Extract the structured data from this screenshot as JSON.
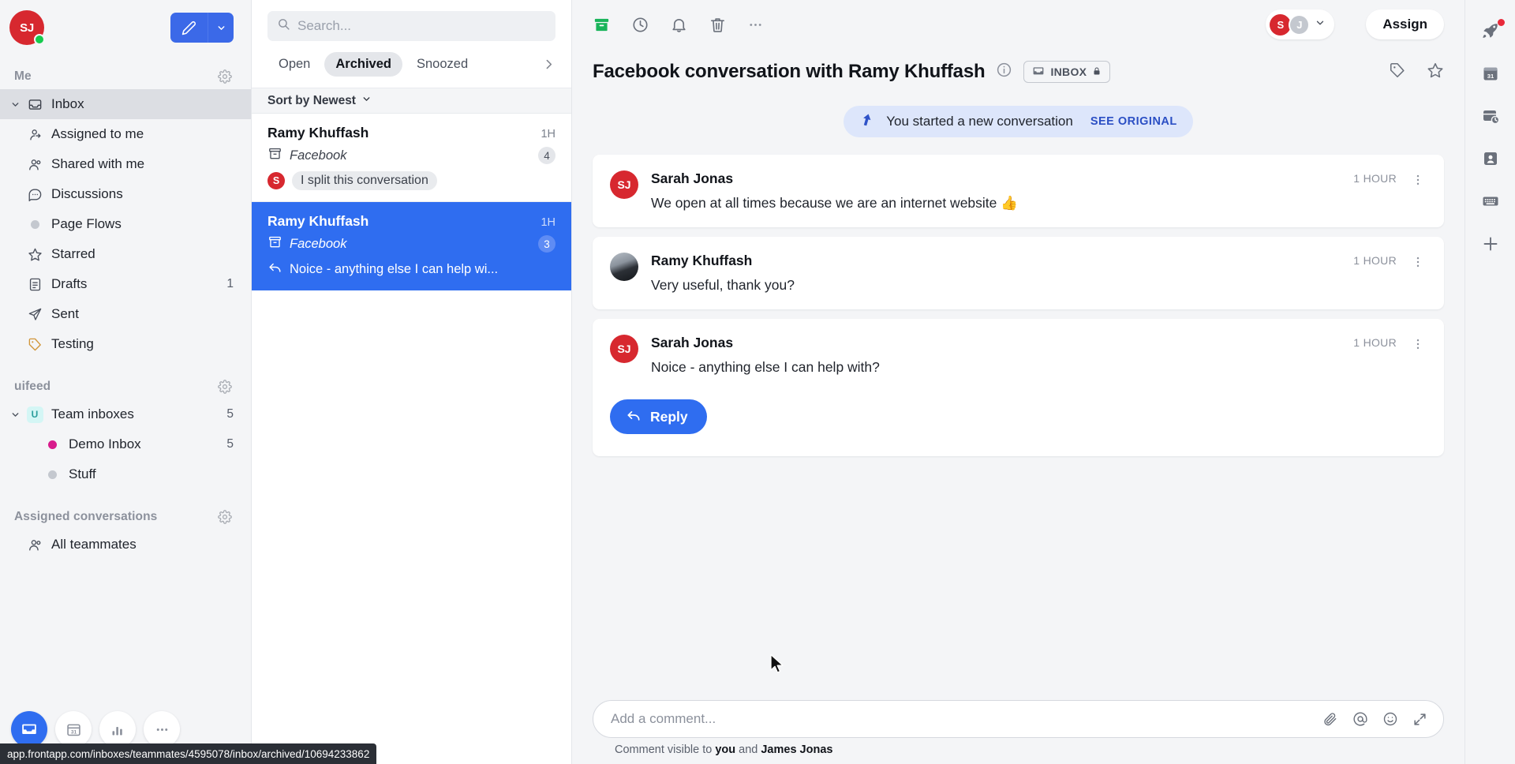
{
  "sidebar": {
    "user_avatar_initials": "SJ",
    "presence": "online",
    "compose_icon": "pencil-icon",
    "compose_caret_icon": "chevron-down-icon",
    "sections": [
      {
        "title": "Me",
        "has_gear": true,
        "items": [
          {
            "label": "Inbox",
            "icon": "inbox-icon",
            "level": 0,
            "selected": true,
            "expanded": true,
            "count": ""
          },
          {
            "label": "Assigned to me",
            "icon": "assigned-user-icon",
            "level": 1,
            "selected": false,
            "count": ""
          },
          {
            "label": "Shared with me",
            "icon": "shared-users-icon",
            "level": 1,
            "selected": false,
            "count": ""
          },
          {
            "label": "Discussions",
            "icon": "chat-bubble-icon",
            "level": 1,
            "selected": false,
            "count": ""
          },
          {
            "label": "Page Flows",
            "icon": "dot-icon",
            "level": 1,
            "selected": false,
            "count": ""
          },
          {
            "label": "Starred",
            "icon": "star-icon",
            "level": 0,
            "selected": false,
            "count": ""
          },
          {
            "label": "Drafts",
            "icon": "draft-document-icon",
            "level": 0,
            "selected": false,
            "count": "1"
          },
          {
            "label": "Sent",
            "icon": "send-paper-plane-icon",
            "level": 0,
            "selected": false,
            "count": ""
          },
          {
            "label": "Testing",
            "icon": "tag-icon",
            "level": 0,
            "selected": false,
            "count": ""
          }
        ]
      },
      {
        "title": "uifeed",
        "has_gear": true,
        "items": [
          {
            "label": "Team inboxes",
            "icon": "team-badge-icon",
            "badge_letter": "U",
            "level": 0,
            "selected": false,
            "expanded": true,
            "count": "5"
          },
          {
            "label": "Demo Inbox",
            "icon": "dot-magenta-icon",
            "level": 1,
            "selected": false,
            "count": "5"
          },
          {
            "label": "Stuff",
            "icon": "dot-icon",
            "level": 1,
            "selected": false,
            "count": ""
          }
        ]
      },
      {
        "title": "Assigned conversations",
        "has_gear": true,
        "items": [
          {
            "label": "All teammates",
            "icon": "shared-users-icon",
            "level": 1,
            "selected": false,
            "count": ""
          }
        ]
      }
    ],
    "dock": [
      {
        "name": "inbox-app-button",
        "icon": "inbox-icon",
        "active": true
      },
      {
        "name": "calendar-app-button",
        "icon": "calendar-31-icon",
        "active": false
      },
      {
        "name": "analytics-app-button",
        "icon": "bar-chart-icon",
        "active": false
      },
      {
        "name": "more-apps-button",
        "icon": "ellipsis-icon",
        "active": false
      }
    ],
    "status_url": "app.frontapp.com/inboxes/teammates/4595078/inbox/archived/10694233862"
  },
  "list": {
    "search": {
      "placeholder": "Search...",
      "value": "",
      "icon": "search-icon"
    },
    "tabs": [
      {
        "label": "Open",
        "active": false
      },
      {
        "label": "Archived",
        "active": true
      },
      {
        "label": "Snoozed",
        "active": false
      }
    ],
    "tabs_more_icon": "chevron-right-icon",
    "sort_label": "Sort by Newest",
    "sort_caret": "chevron-down-icon",
    "conversations": [
      {
        "name": "Ramy Khuffash",
        "time": "1H",
        "channel": "Facebook",
        "channel_icon": "archive-box-icon",
        "badge": "4",
        "preview": "I split this conversation",
        "preview_style": "pill",
        "preview_avatar": "S",
        "active": false
      },
      {
        "name": "Ramy Khuffash",
        "time": "1H",
        "channel": "Facebook",
        "channel_icon": "archive-box-icon",
        "badge": "3",
        "preview": "Noice - anything else I can help wi...",
        "preview_style": "reply",
        "preview_icon": "reply-arrow-icon",
        "active": true
      }
    ]
  },
  "main": {
    "toolbar": [
      {
        "name": "archive-button",
        "icon": "archive-filled-icon",
        "color": "#19b45a"
      },
      {
        "name": "snooze-button",
        "icon": "clock-icon",
        "color": "#6b717c"
      },
      {
        "name": "reminder-button",
        "icon": "bell-icon",
        "color": "#6b717c"
      },
      {
        "name": "trash-button",
        "icon": "trash-icon",
        "color": "#6b717c"
      },
      {
        "name": "more-actions-button",
        "icon": "ellipsis-icon",
        "color": "#6b717c"
      }
    ],
    "assignees": [
      {
        "initials": "S",
        "color": "#d7282f"
      },
      {
        "initials": "J",
        "color": "#c4c8cf"
      }
    ],
    "assignee_caret": "chevron-down-icon",
    "assign_label": "Assign",
    "title": "Facebook conversation with Ramy Khuffash",
    "info_icon": "info-circle-icon",
    "inbox_tag": {
      "label": "INBOX",
      "icon": "inbox-icon",
      "lock_icon": "lock-icon"
    },
    "head_right": [
      {
        "name": "tag-conversation-button",
        "icon": "tag-icon"
      },
      {
        "name": "star-conversation-button",
        "icon": "star-icon"
      }
    ],
    "system_banner": {
      "icon": "split-arrow-icon",
      "text": "You started a new conversation",
      "link": "SEE ORIGINAL"
    },
    "messages": [
      {
        "author": "Sarah Jonas",
        "avatar_initials": "SJ",
        "avatar_type": "initials",
        "avatar_color": "#d7282f",
        "time": "1 HOUR",
        "text": "We open at all times because we are an internet website 👍",
        "kebab_icon": "vertical-ellipsis-icon",
        "has_reply": false
      },
      {
        "author": "Ramy Khuffash",
        "avatar_initials": "",
        "avatar_type": "photo",
        "avatar_color": "",
        "time": "1 HOUR",
        "text": "Very useful, thank you?",
        "kebab_icon": "vertical-ellipsis-icon",
        "has_reply": false
      },
      {
        "author": "Sarah Jonas",
        "avatar_initials": "SJ",
        "avatar_type": "initials",
        "avatar_color": "#d7282f",
        "time": "1 HOUR",
        "text": "Noice - anything else I can help with?",
        "kebab_icon": "vertical-ellipsis-icon",
        "has_reply": true,
        "reply_label": "Reply",
        "reply_icon": "reply-arrow-icon"
      }
    ],
    "composer": {
      "placeholder": "Add a comment...",
      "value": "",
      "icons": [
        {
          "name": "attachment-icon"
        },
        {
          "name": "mention-at-icon"
        },
        {
          "name": "emoji-icon"
        },
        {
          "name": "expand-icon"
        }
      ],
      "note_prefix": "Comment visible to ",
      "note_you": "you",
      "note_mid": " and ",
      "note_person": "James Jonas"
    }
  },
  "rail": [
    {
      "name": "rocket-plugin-button",
      "icon": "rocket-icon",
      "badge": true
    },
    {
      "name": "calendar-plugin-button",
      "icon": "calendar-31-icon",
      "badge": false
    },
    {
      "name": "snooze-plugin-button",
      "icon": "archive-clock-icon",
      "badge": false
    },
    {
      "name": "contacts-plugin-button",
      "icon": "contact-card-icon",
      "badge": false
    },
    {
      "name": "shortcuts-plugin-button",
      "icon": "keyboard-icon",
      "badge": false
    },
    {
      "name": "add-plugin-button",
      "icon": "plus-icon",
      "badge": false
    }
  ],
  "colors": {
    "accent_blue": "#2f6df0",
    "compose_blue": "#3b69e8",
    "avatar_red": "#d7282f",
    "archive_green": "#19b45a",
    "magenta_dot": "#d81b8c",
    "link_blue": "#2b4fc4"
  }
}
